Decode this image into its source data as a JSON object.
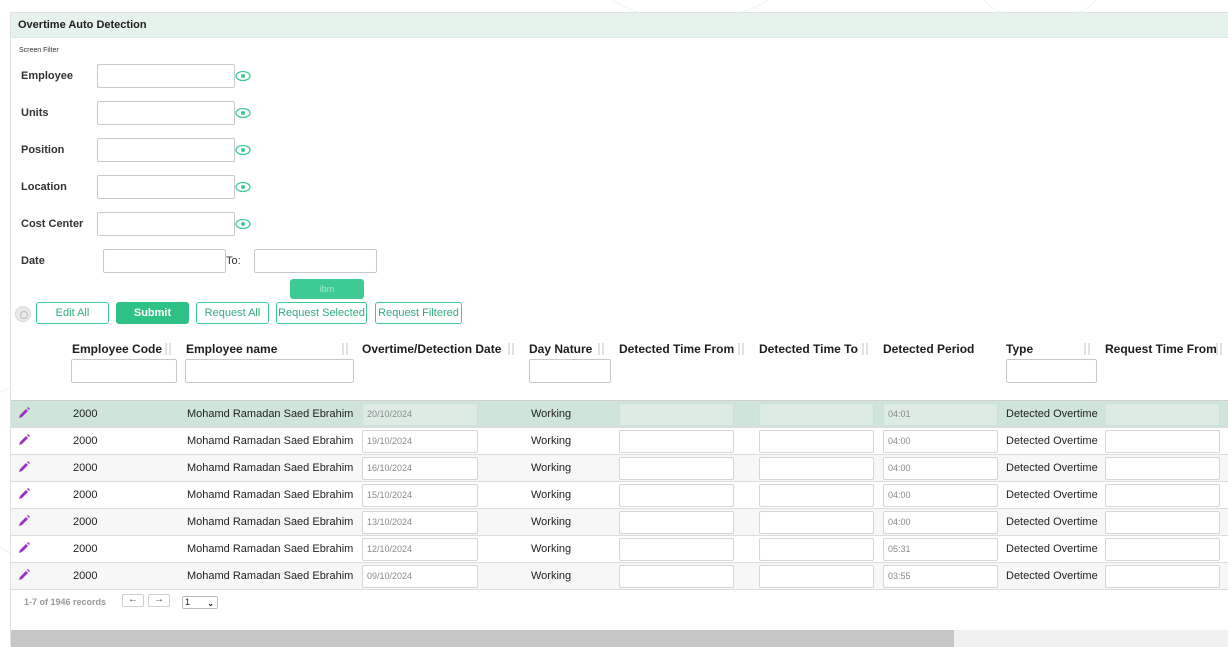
{
  "header": {
    "title": "Overtime Auto Detection"
  },
  "filter": {
    "legend": "Screen Filter",
    "fields": [
      {
        "label": "Employee",
        "value": ""
      },
      {
        "label": "Units",
        "value": ""
      },
      {
        "label": "Position",
        "value": ""
      },
      {
        "label": "Location",
        "value": ""
      },
      {
        "label": "Cost Center",
        "value": ""
      }
    ],
    "date": {
      "label": "Date",
      "from": "",
      "to_label": "To:",
      "to": ""
    },
    "ibm_label": "ibm"
  },
  "toolbar": {
    "edit_all": "Edit All",
    "submit": "Submit",
    "request_all": "Request All",
    "request_selected": "Request Selected",
    "request_filtered": "Request Filtered"
  },
  "columns": [
    "Employee Code",
    "Employee name",
    "Overtime/Detection Date",
    "Day Nature",
    "Detected Time From",
    "Detected Time To",
    "Detected Period",
    "Type",
    "Request Time From"
  ],
  "rows": [
    {
      "code": "2000",
      "name": "Mohamd Ramadan Saed Ebrahim",
      "date": "20/10/2024",
      "nature": "Working",
      "from": "",
      "to": "",
      "period": "04:01",
      "type": "Detected Overtime",
      "req_from": ""
    },
    {
      "code": "2000",
      "name": "Mohamd Ramadan Saed Ebrahim",
      "date": "19/10/2024",
      "nature": "Working",
      "from": "",
      "to": "",
      "period": "04:00",
      "type": "Detected Overtime",
      "req_from": ""
    },
    {
      "code": "2000",
      "name": "Mohamd Ramadan Saed Ebrahim",
      "date": "16/10/2024",
      "nature": "Working",
      "from": "",
      "to": "",
      "period": "04:00",
      "type": "Detected Overtime",
      "req_from": ""
    },
    {
      "code": "2000",
      "name": "Mohamd Ramadan Saed Ebrahim",
      "date": "15/10/2024",
      "nature": "Working",
      "from": "",
      "to": "",
      "period": "04:00",
      "type": "Detected Overtime",
      "req_from": ""
    },
    {
      "code": "2000",
      "name": "Mohamd Ramadan Saed Ebrahim",
      "date": "13/10/2024",
      "nature": "Working",
      "from": "",
      "to": "",
      "period": "04:00",
      "type": "Detected Overtime",
      "req_from": ""
    },
    {
      "code": "2000",
      "name": "Mohamd Ramadan Saed Ebrahim",
      "date": "12/10/2024",
      "nature": "Working",
      "from": "",
      "to": "",
      "period": "05:31",
      "type": "Detected Overtime",
      "req_from": ""
    },
    {
      "code": "2000",
      "name": "Mohamd Ramadan Saed Ebrahim",
      "date": "09/10/2024",
      "nature": "Working",
      "from": "",
      "to": "",
      "period": "03:55",
      "type": "Detected Overtime",
      "req_from": ""
    }
  ],
  "pager": {
    "summary": "1-7 of 1946 records",
    "prev": "←",
    "next": "→",
    "page": "1"
  },
  "colors": {
    "accent": "#2fc287",
    "header_bg": "#e6f2ec",
    "selected_row": "#cfe5da",
    "edit_icon": "#9b30c6"
  },
  "icons": {
    "filter_visibility": "eye-icon",
    "row_edit": "pencil-icon",
    "sort": "sort-icon"
  }
}
